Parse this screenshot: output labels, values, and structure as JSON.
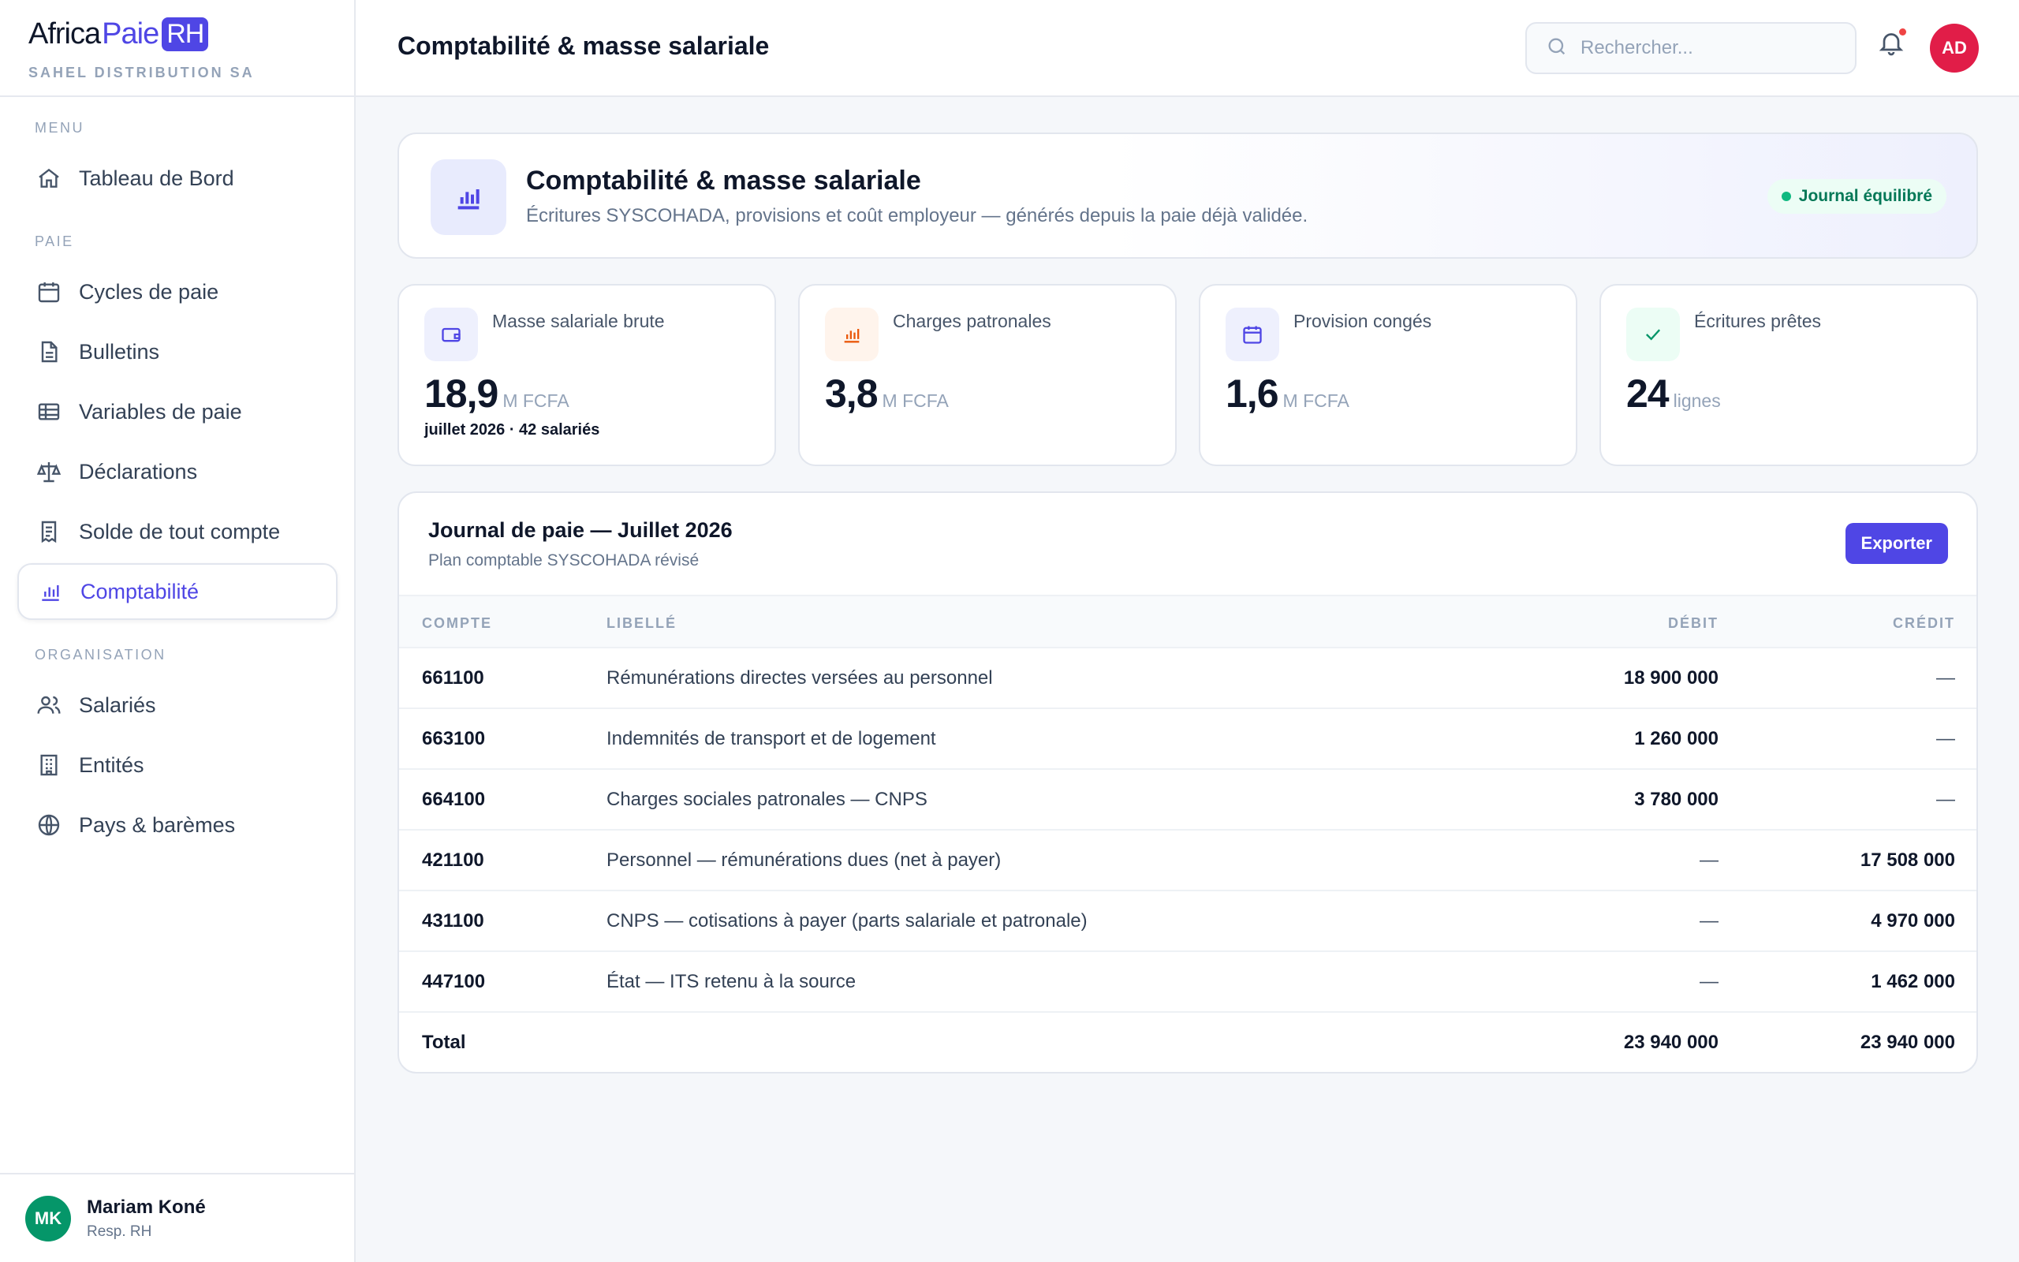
{
  "app": {
    "logo_africa": "Africa",
    "logo_paie": "Paie",
    "logo_rh": "RH",
    "company": "SAHEL DISTRIBUTION SA"
  },
  "sidebar": {
    "menu_label": "MENU",
    "paie_label": "PAIE",
    "organisation_label": "ORGANISATION",
    "items": [
      {
        "label": "Tableau de Bord",
        "icon": "home-icon"
      },
      {
        "label": "Cycles de paie",
        "icon": "calendar-icon"
      },
      {
        "label": "Bulletins",
        "icon": "document-icon"
      },
      {
        "label": "Variables de paie",
        "icon": "table-icon"
      },
      {
        "label": "Déclarations",
        "icon": "scale-icon"
      },
      {
        "label": "Solde de tout compte",
        "icon": "receipt-icon"
      },
      {
        "label": "Comptabilité",
        "icon": "bar-chart-icon",
        "active": true
      },
      {
        "label": "Salariés",
        "icon": "users-icon"
      },
      {
        "label": "Entités",
        "icon": "building-icon"
      },
      {
        "label": "Pays & barèmes",
        "icon": "globe-icon"
      }
    ],
    "user": {
      "initials": "MK",
      "name": "Mariam Koné",
      "role": "Resp. RH"
    }
  },
  "header": {
    "title": "Comptabilité & masse salariale",
    "search_placeholder": "Rechercher...",
    "avatar_initials": "AD"
  },
  "hero": {
    "title": "Comptabilité & masse salariale",
    "subtitle": "Écritures SYSCOHADA, provisions et coût employeur — générés depuis la paie déjà validée.",
    "badge": "Journal équilibré"
  },
  "stats": [
    {
      "label": "Masse salariale brute",
      "value": "18,9",
      "unit": "M FCFA",
      "note": "juillet 2026 · 42 salariés",
      "icon": "wallet-icon",
      "color": "#4f46e5",
      "bg": "#eef0fd"
    },
    {
      "label": "Charges patronales",
      "value": "3,8",
      "unit": "M FCFA",
      "note": "",
      "icon": "bar-chart-icon",
      "color": "#ea580c",
      "bg": "#fff4ec"
    },
    {
      "label": "Provision congés",
      "value": "1,6",
      "unit": "M FCFA",
      "note": "",
      "icon": "calendar-icon",
      "color": "#4f46e5",
      "bg": "#eef0fd"
    },
    {
      "label": "Écritures prêtes",
      "value": "24",
      "unit": "lignes",
      "note": "",
      "icon": "check-icon",
      "color": "#059669",
      "bg": "#ecfdf5"
    }
  ],
  "journal": {
    "title": "Journal de paie — Juillet 2026",
    "subtitle": "Plan comptable SYSCOHADA révisé",
    "export_label": "Exporter",
    "columns": {
      "compte": "COMPTE",
      "libelle": "LIBELLÉ",
      "debit": "DÉBIT",
      "credit": "CRÉDIT"
    },
    "rows": [
      {
        "compte": "661100",
        "libelle": "Rémunérations directes versées au personnel",
        "debit": "18 900 000",
        "credit": "—"
      },
      {
        "compte": "663100",
        "libelle": "Indemnités de transport et de logement",
        "debit": "1 260 000",
        "credit": "—"
      },
      {
        "compte": "664100",
        "libelle": "Charges sociales patronales — CNPS",
        "debit": "3 780 000",
        "credit": "—"
      },
      {
        "compte": "421100",
        "libelle": "Personnel — rémunérations dues (net à payer)",
        "debit": "—",
        "credit": "17 508 000"
      },
      {
        "compte": "431100",
        "libelle": "CNPS — cotisations à payer (parts salariale et patronale)",
        "debit": "—",
        "credit": "4 970 000"
      },
      {
        "compte": "447100",
        "libelle": "État — ITS retenu à la source",
        "debit": "—",
        "credit": "1 462 000"
      }
    ],
    "total": {
      "label": "Total",
      "debit": "23 940 000",
      "credit": "23 940 000"
    }
  }
}
